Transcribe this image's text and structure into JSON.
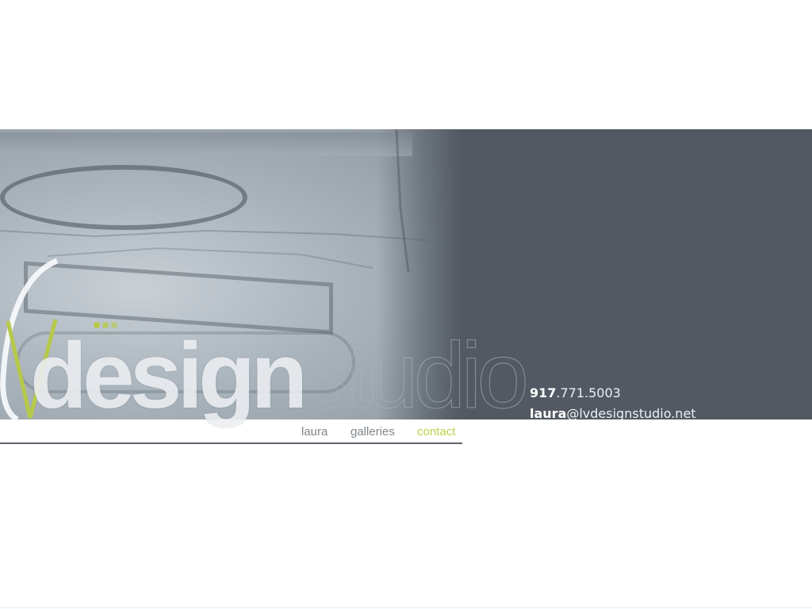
{
  "brand": {
    "letter_l": "l",
    "letter_v": "V",
    "word_bold": "design",
    "word_thin": "studio",
    "accent_color": "#b7c94a",
    "panel_color": "#525963"
  },
  "contact": {
    "phone_prefix": "917",
    "phone_rest": ".771.5003",
    "email_user": "laura",
    "email_domain": "@lvdesignstudio.net"
  },
  "nav": {
    "items": [
      {
        "label": "laura"
      },
      {
        "label": "galleries"
      },
      {
        "label": "contact",
        "active": true
      }
    ]
  }
}
